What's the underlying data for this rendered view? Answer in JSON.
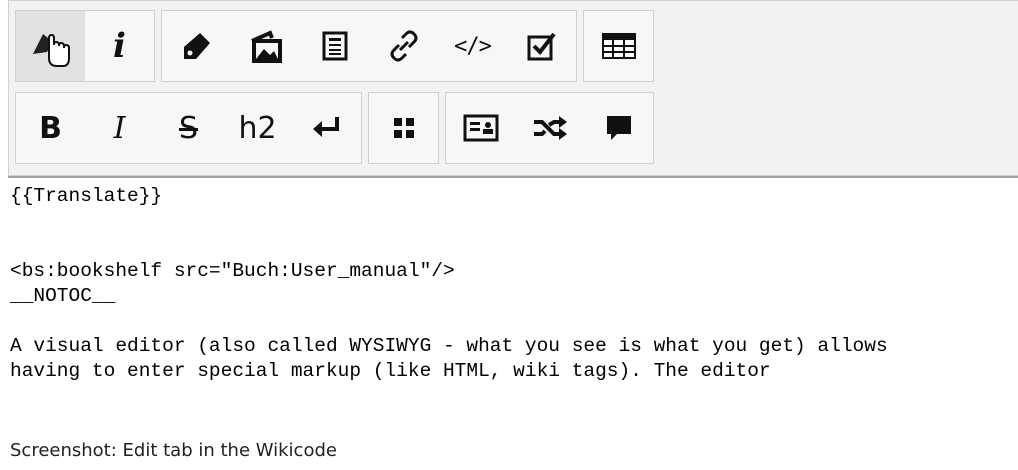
{
  "toolbar": {
    "row1": [
      {
        "group": "mode",
        "buttons": [
          {
            "name": "pointer-hand-icon",
            "kind": "icon",
            "active": true
          },
          {
            "name": "info-icon",
            "kind": "glyph",
            "label": "i"
          }
        ]
      },
      {
        "group": "insert",
        "buttons": [
          {
            "name": "tag-icon",
            "kind": "icon"
          },
          {
            "name": "image-icon",
            "kind": "icon"
          },
          {
            "name": "page-icon",
            "kind": "icon"
          },
          {
            "name": "link-icon",
            "kind": "icon"
          },
          {
            "name": "code-icon",
            "kind": "glyph",
            "label": "</>"
          },
          {
            "name": "checkbox-icon",
            "kind": "icon"
          }
        ]
      },
      {
        "group": "table",
        "buttons": [
          {
            "name": "table-icon",
            "kind": "icon"
          }
        ]
      }
    ],
    "row2": [
      {
        "group": "format",
        "buttons": [
          {
            "name": "bold",
            "kind": "glyph",
            "label": "B"
          },
          {
            "name": "italic",
            "kind": "glyph",
            "label": "I"
          },
          {
            "name": "strikethrough",
            "kind": "glyph",
            "label": "S"
          },
          {
            "name": "heading2",
            "kind": "glyph",
            "label": "h2"
          },
          {
            "name": "enter-icon",
            "kind": "icon"
          }
        ]
      },
      {
        "group": "grid",
        "buttons": [
          {
            "name": "grid-icon",
            "kind": "icon"
          }
        ]
      },
      {
        "group": "misc",
        "buttons": [
          {
            "name": "id-card-icon",
            "kind": "icon"
          },
          {
            "name": "shuffle-icon",
            "kind": "icon"
          },
          {
            "name": "comment-icon",
            "kind": "icon"
          }
        ]
      }
    ]
  },
  "editor": {
    "lines": [
      "{{Translate}}",
      "",
      "",
      "<bs:bookshelf src=\"Buch:User_manual\"/>",
      "__NOTOC__",
      "",
      "A visual editor (also called WYSIWYG - what you see is what you get) allows",
      "having to enter special markup (like HTML, wiki tags). The editor"
    ]
  },
  "caption": "Screenshot: Edit tab in the Wikicode"
}
